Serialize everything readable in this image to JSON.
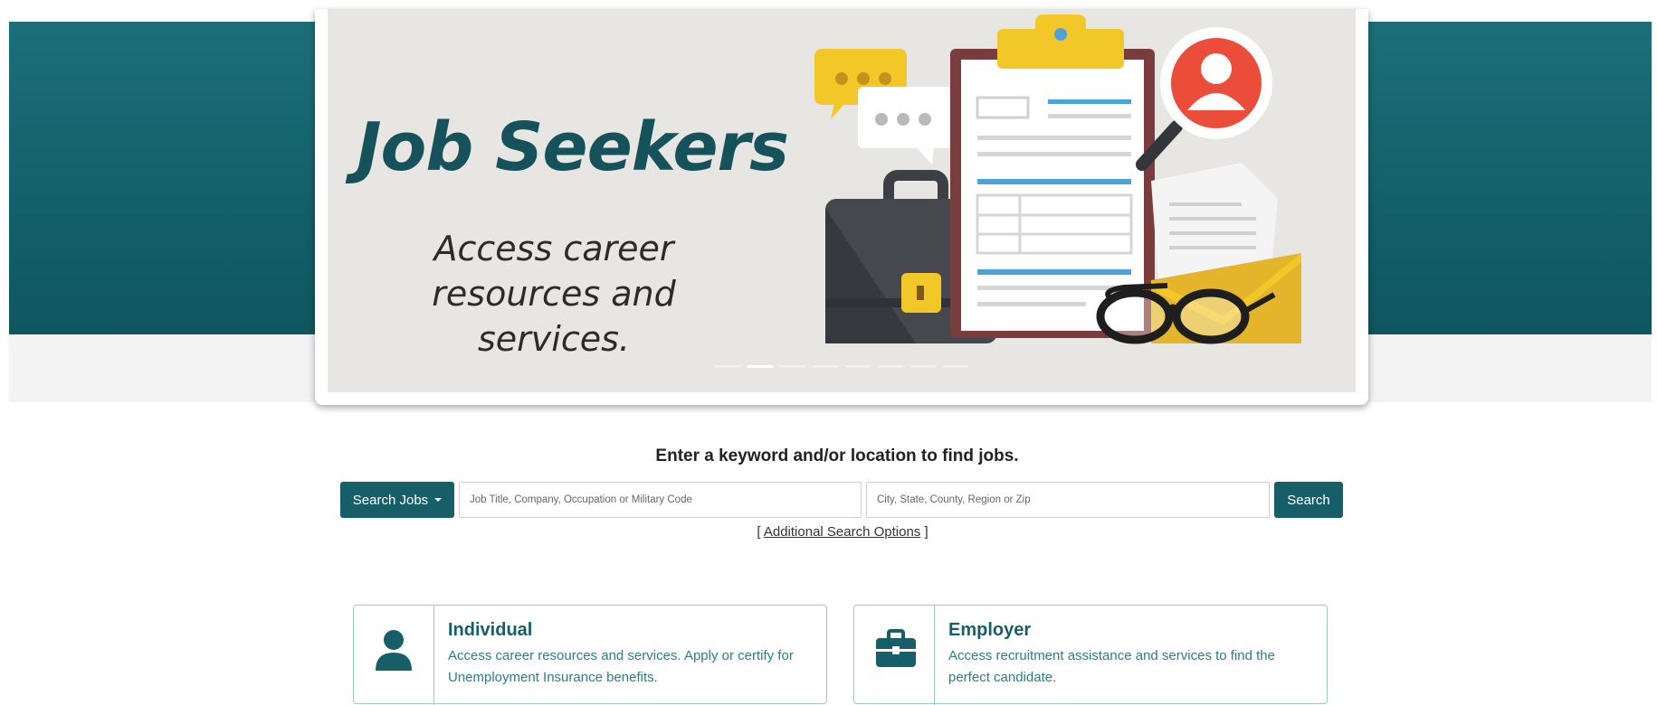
{
  "hero": {
    "title": "Job Seekers",
    "subtitle": "Access career resources and services.",
    "slides": 8,
    "active_slide": 2
  },
  "search": {
    "prompt": "Enter a keyword and/or location to find jobs.",
    "type_button_label": "Search Jobs",
    "keyword_placeholder": "Job Title, Company, Occupation or Military Code",
    "location_placeholder": "City, State, County, Region or Zip",
    "submit_label": "Search",
    "additional_options_prefix": "[",
    "additional_options_link": "Additional Search Options",
    "additional_options_suffix": "]"
  },
  "cards": [
    {
      "title": "Individual",
      "description": "Access career resources and services. Apply or certify for Unemployment Insurance benefits.",
      "icon": "person-icon"
    },
    {
      "title": "Employer",
      "description": "Access recruitment assistance and services to find the perfect candidate.",
      "icon": "briefcase-icon"
    }
  ],
  "colors": {
    "brand_teal": "#175f68",
    "band_teal": "#13616b",
    "card_border": "#9bc6cb",
    "hero_title": "#15525b"
  }
}
